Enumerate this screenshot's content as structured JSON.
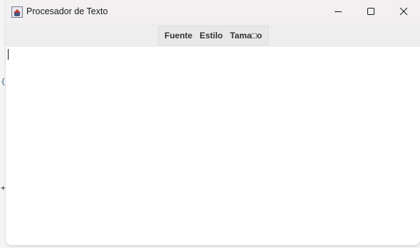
{
  "window": {
    "title": "Procesador de Texto",
    "icon": "java-cup-icon"
  },
  "caption_buttons": {
    "minimize": "minimize-icon",
    "maximize": "maximize-icon",
    "close": "close-icon"
  },
  "menubar": {
    "items": [
      {
        "label": "Fuente"
      },
      {
        "label": "Estilo"
      },
      {
        "label": "Tama□o"
      }
    ]
  },
  "editor": {
    "content": ""
  },
  "desktop": {
    "edge_glyphs": [
      "{",
      "+"
    ]
  },
  "colors": {
    "titlebar": "#f3f0f1",
    "menubar": "#eeeeee",
    "editor": "#ffffff",
    "text": "#1a1a1a"
  }
}
